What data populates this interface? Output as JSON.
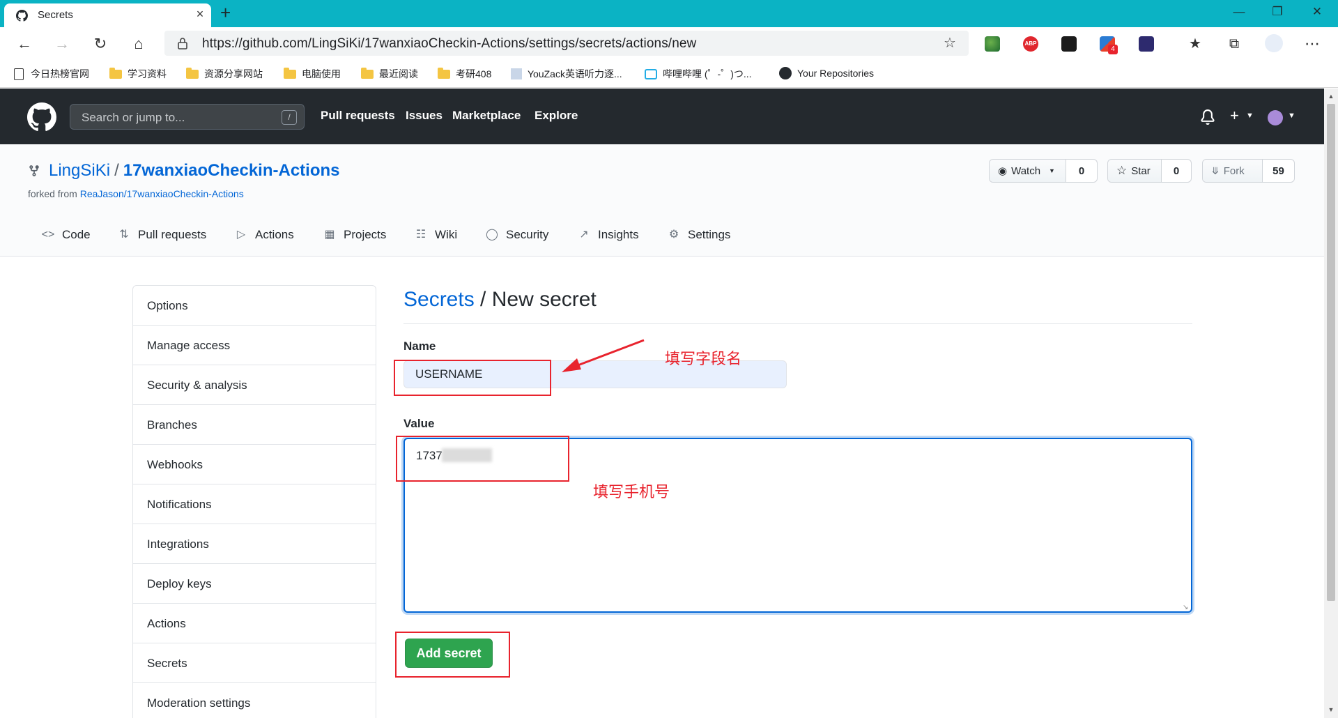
{
  "browser": {
    "tab_title": "Secrets",
    "new_tab": "+",
    "close_tab": "×",
    "url": "https://github.com/LingSiKi/17wanxiaoCheckin-Actions/settings/secrets/actions/new",
    "bookmarks": [
      "今日热榜官网",
      "学习资料",
      "资源分享网站",
      "电脑使用",
      "最近阅读",
      "考研408",
      "YouZack英语听力逐...",
      "哔哩哔哩 (゜-゜)つ...",
      "Your Repositories"
    ],
    "extensions": [
      "globe-extension-icon",
      "abp-icon",
      "mask-extension-icon",
      "puzzle-extension-icon",
      "bracket-extension-icon"
    ],
    "extension_badge": "4",
    "abp_label": "ABP"
  },
  "github": {
    "search_placeholder": "Search or jump to...",
    "search_key": "/",
    "nav": [
      "Pull requests",
      "Issues",
      "Marketplace",
      "Explore"
    ]
  },
  "repo": {
    "owner": "LingSiKi",
    "separator": "/",
    "name": "17wanxiaoCheckin-Actions",
    "forked_prefix": "forked from",
    "forked_from": "ReaJason/17wanxiaoCheckin-Actions",
    "watch_label": "Watch",
    "watch_count": "0",
    "star_label": "Star",
    "star_count": "0",
    "fork_label": "Fork",
    "fork_count": "59",
    "tabs": [
      "Code",
      "Pull requests",
      "Actions",
      "Projects",
      "Wiki",
      "Security",
      "Insights",
      "Settings"
    ]
  },
  "settings_menu": [
    "Options",
    "Manage access",
    "Security & analysis",
    "Branches",
    "Webhooks",
    "Notifications",
    "Integrations",
    "Deploy keys",
    "Actions",
    "Secrets",
    "Moderation settings"
  ],
  "form": {
    "breadcrumb_link": "Secrets",
    "breadcrumb_sep": " / ",
    "breadcrumb_current": "New secret",
    "name_label": "Name",
    "name_value": "USERNAME",
    "value_label": "Value",
    "value_text": "1737",
    "submit_label": "Add secret"
  },
  "annotations": {
    "name_note": "填写字段名",
    "value_note": "填写手机号",
    "color": "#e8232d"
  },
  "colors": {
    "tabbar": "#0bb3c4",
    "gh_header": "#24292e",
    "link": "#0366d6",
    "primary_button": "#2ea44f"
  }
}
